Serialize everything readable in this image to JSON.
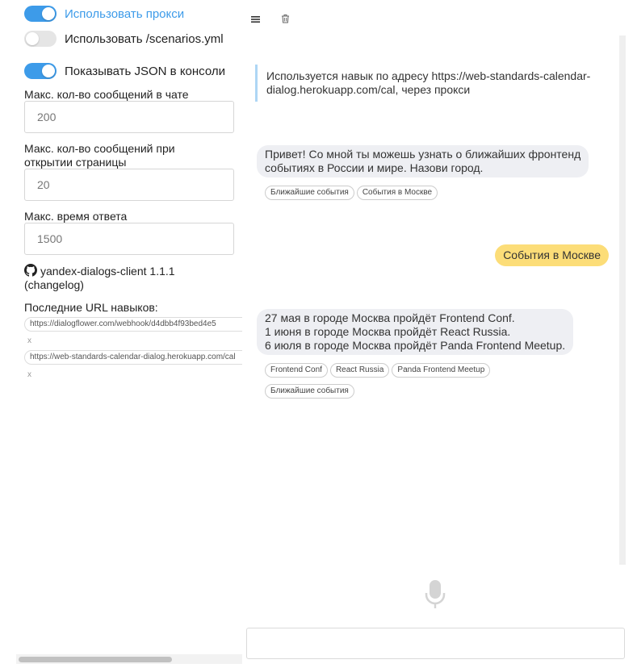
{
  "settings": {
    "use_proxy": {
      "label": "Использовать прокси",
      "on": true
    },
    "use_scenarios": {
      "label": "Использовать /scenarios.yml",
      "on": false
    },
    "show_json": {
      "label": "Показывать JSON в консоли",
      "on": true
    },
    "max_messages_chat": {
      "label": "Макс. кол-во сообщений в чате",
      "value": "200"
    },
    "max_messages_open": {
      "label": "Макс. кол-во сообщений при открытии страницы",
      "value": "20"
    },
    "max_response_time": {
      "label": "Макс. время ответа",
      "value": "1500"
    }
  },
  "app_info": {
    "name": "yandex-dialogs-client 1.1.1",
    "changelog": "(changelog)"
  },
  "recent_urls": {
    "title": "Последние URL навыков:",
    "items": [
      {
        "url": "https://dialogflower.com/webhook/d4dbb4f93bed4e5",
        "remove": "x"
      },
      {
        "url": "https://web-standards-calendar-dialog.herokuapp.com/cal",
        "remove": "x"
      }
    ]
  },
  "toolbar": {
    "menu_icon": "menu-icon",
    "trash_icon": "trash-icon"
  },
  "chat": {
    "info": "Используется навык по адресу https://web-standards-calendar-dialog.herokuapp.com/cal, через прокси",
    "messages": [
      {
        "from": "bot",
        "lines": [
          "Привет! Со мной ты можешь узнать о ближайших фронтенд",
          "событиях в России и мире. Назови город."
        ],
        "buttons": [
          "Ближайшие события",
          "События в Москве"
        ]
      },
      {
        "from": "user",
        "text": "События в Москве"
      },
      {
        "from": "bot",
        "lines": [
          "27 мая в городе Москва пройдёт Frontend Conf.",
          "1 июня в городе Москва пройдёт React Russia.",
          "6 июля в городе Москва пройдёт Panda Frontend Meetup."
        ],
        "buttons": [
          "Frontend Conf",
          "React Russia",
          "Panda Frontend Meetup",
          "Ближайшие события"
        ]
      }
    ],
    "input": {
      "value": "",
      "placeholder": ""
    }
  },
  "colors": {
    "accent": "#3d9be9",
    "user_bubble": "#fcdd78",
    "bot_bubble": "#eeeff3",
    "info_border": "#aed6f5"
  }
}
